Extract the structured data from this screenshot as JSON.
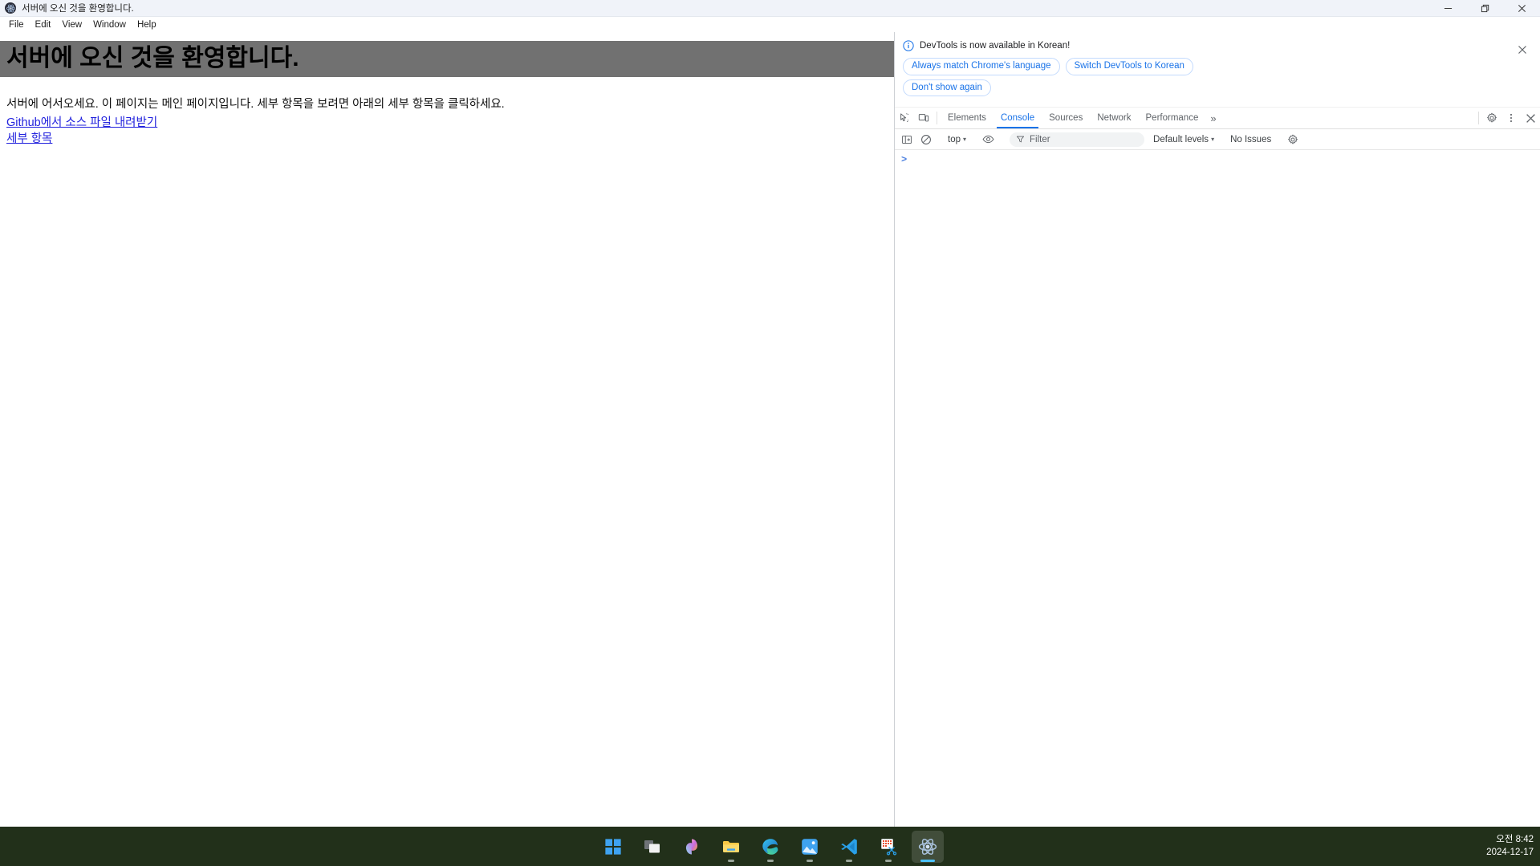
{
  "window": {
    "title": "서버에 오신 것을 환영합니다.",
    "app_icon": "electron-atom-icon",
    "controls": {
      "minimize": "minimize-icon",
      "restore": "restore-icon",
      "close": "close-icon"
    }
  },
  "menubar": {
    "items": [
      {
        "label": "File"
      },
      {
        "label": "Edit"
      },
      {
        "label": "View"
      },
      {
        "label": "Window"
      },
      {
        "label": "Help"
      }
    ]
  },
  "page": {
    "heading": "서버에 오신 것을 환영합니다.",
    "heading_bg": "#717171",
    "paragraph": "서버에 어서오세요. 이 페이지는 메인 페이지입니다. 세부 항목을 보려면 아래의 세부 항목을 클릭하세요.",
    "links": [
      {
        "text": "Github에서 소스 파일 내려받기"
      },
      {
        "text": "세부 항목"
      }
    ],
    "link_color": "#2222dd"
  },
  "devtools": {
    "notification": {
      "icon": "info-circle-icon",
      "message": "DevTools is now available in Korean!",
      "buttons": [
        {
          "label": "Always match Chrome's language"
        },
        {
          "label": "Switch DevTools to Korean"
        },
        {
          "label": "Don't show again"
        }
      ],
      "close_icon": "close-icon",
      "accent": "#1a73e8"
    },
    "tabbar": {
      "left_icons": [
        {
          "name": "inspect-element-icon"
        },
        {
          "name": "device-toolbar-icon"
        }
      ],
      "tabs": [
        {
          "label": "Elements",
          "active": false
        },
        {
          "label": "Console",
          "active": true
        },
        {
          "label": "Sources",
          "active": false
        },
        {
          "label": "Network",
          "active": false
        },
        {
          "label": "Performance",
          "active": false
        }
      ],
      "more_tabs": "»",
      "right_icons": [
        {
          "name": "settings-gear-icon"
        },
        {
          "name": "more-options-kebab-icon"
        },
        {
          "name": "close-devtools-icon"
        }
      ],
      "active_tab_color": "#1a73e8"
    },
    "console_toolbar": {
      "sidebar_toggle": "console-sidebar-icon",
      "clear_console": "clear-console-icon",
      "context": "top",
      "context_caret": "▾",
      "live_expression": "eye-icon",
      "filter_icon": "filter-funnel-icon",
      "filter_value": "",
      "filter_placeholder": "Filter",
      "levels": "Default levels",
      "levels_caret": "▾",
      "issues": "No Issues",
      "settings": "console-settings-gear-icon"
    },
    "console": {
      "prompt": ">",
      "input_value": ""
    }
  },
  "taskbar": {
    "bg": "#22301a",
    "items": [
      {
        "name": "start-button",
        "label": "Start",
        "active": false,
        "running": false
      },
      {
        "name": "task-view-button",
        "label": "Task view",
        "active": false,
        "running": false
      },
      {
        "name": "copilot-button",
        "label": "Copilot",
        "active": false,
        "running": false
      },
      {
        "name": "file-explorer-button",
        "label": "File Explorer",
        "active": false,
        "running": true
      },
      {
        "name": "microsoft-edge-button",
        "label": "Microsoft Edge",
        "active": false,
        "running": true
      },
      {
        "name": "photos-button",
        "label": "Photos",
        "active": false,
        "running": true
      },
      {
        "name": "vscode-button",
        "label": "Visual Studio Code",
        "active": false,
        "running": true
      },
      {
        "name": "snipping-tool-button",
        "label": "Snipping Tool",
        "active": false,
        "running": true
      },
      {
        "name": "electron-app-button",
        "label": "Electron App",
        "active": true,
        "running": true
      }
    ],
    "clock": {
      "time": "오전 8:42",
      "date": "2024-12-17"
    }
  }
}
